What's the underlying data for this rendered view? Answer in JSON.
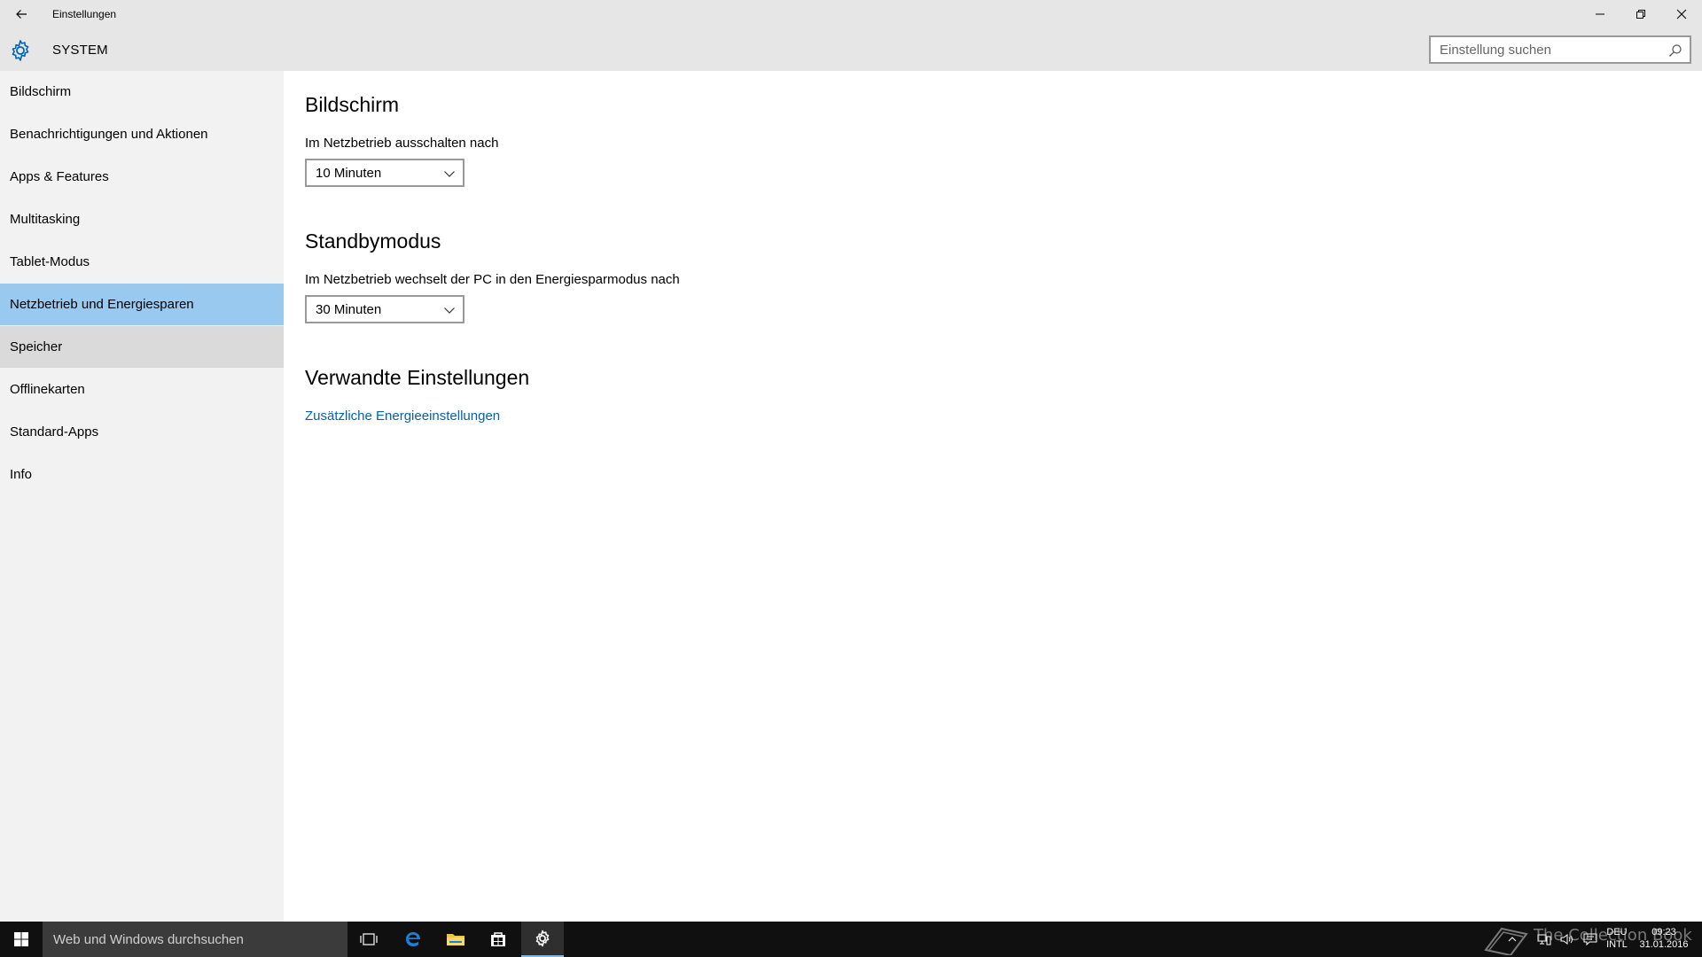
{
  "window": {
    "title": "Einstellungen",
    "back_icon": "back-arrow-icon",
    "min_icon": "minimize-icon",
    "max_icon": "restore-icon",
    "close_icon": "close-icon"
  },
  "header": {
    "section_title": "SYSTEM",
    "icon": "gear-icon",
    "accent": "#0063b1",
    "search_placeholder": "Einstellung suchen"
  },
  "sidebar": {
    "items": [
      {
        "label": "Bildschirm"
      },
      {
        "label": "Benachrichtigungen und Aktionen"
      },
      {
        "label": "Apps & Features"
      },
      {
        "label": "Multitasking"
      },
      {
        "label": "Tablet-Modus"
      },
      {
        "label": "Netzbetrieb und Energiesparen",
        "selected": true
      },
      {
        "label": "Speicher",
        "hover": true
      },
      {
        "label": "Offlinekarten"
      },
      {
        "label": "Standard-Apps"
      },
      {
        "label": "Info"
      }
    ],
    "selected_color": "#99c9ef"
  },
  "content": {
    "screen": {
      "heading": "Bildschirm",
      "label": "Im Netzbetrieb ausschalten nach",
      "value": "10 Minuten"
    },
    "standby": {
      "heading": "Standbymodus",
      "label": "Im Netzbetrieb wechselt der PC in den Energiesparmodus nach",
      "value": "30 Minuten"
    },
    "related": {
      "heading": "Verwandte Einstellungen",
      "link": "Zusätzliche Energieeinstellungen"
    }
  },
  "taskbar": {
    "search_text": "Web und Windows durchsuchen",
    "apps": [
      "task-view-icon",
      "edge-icon",
      "file-explorer-icon",
      "store-icon",
      "settings-gear-icon"
    ],
    "lang_top": "DEU",
    "lang_bottom": "INTL",
    "time": "09:23",
    "date": "31.01.2016",
    "watermark": "The Collection Book"
  }
}
